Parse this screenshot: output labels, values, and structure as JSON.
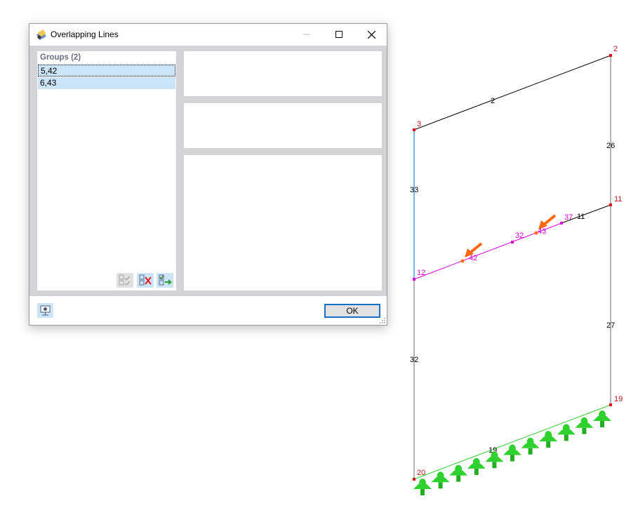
{
  "dialog": {
    "title": "Overlapping Lines",
    "groups_header": "Groups (2)",
    "groups": [
      "5,42",
      "6,43"
    ],
    "ok_label": "OK"
  },
  "model": {
    "nodes": [
      {
        "id": "2",
        "label": "2"
      },
      {
        "id": "3",
        "label": "3"
      },
      {
        "id": "11",
        "label": "11"
      },
      {
        "id": "12",
        "label": "12"
      },
      {
        "id": "19",
        "label": "19"
      },
      {
        "id": "20",
        "label": "20"
      }
    ],
    "lines": [
      {
        "id": "line-2",
        "label": "2"
      },
      {
        "id": "line-26",
        "label": "26"
      },
      {
        "id": "line-33",
        "label": "33"
      },
      {
        "id": "line-11",
        "label": "11"
      },
      {
        "id": "line-37",
        "label": "37"
      },
      {
        "id": "line-32-magenta",
        "label": "32"
      },
      {
        "id": "line-42",
        "label": "42"
      },
      {
        "id": "line-43",
        "label": "43"
      },
      {
        "id": "line-27",
        "label": "27"
      },
      {
        "id": "line-32",
        "label": "32"
      },
      {
        "id": "line-19",
        "label": "19"
      }
    ],
    "colors": {
      "node": "#e0101a",
      "node_label": "#c8101a",
      "line": "#000000",
      "member": "#b4b4b4",
      "selected_line": "#dd00dd",
      "highlight_line": "#72b8e6",
      "support": "#2fd12f",
      "arrow": "#ff6a10"
    }
  }
}
